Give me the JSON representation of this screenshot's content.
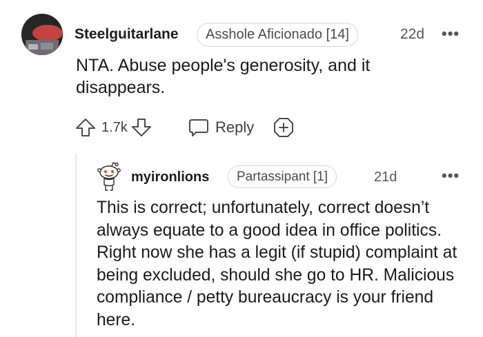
{
  "comment": {
    "username": "Steelguitarlane",
    "flair": "Asshole Aficionado [14]",
    "age": "22d",
    "more": "•••",
    "body": "NTA. Abuse people's generosity, and it disappears.",
    "votes": "1.7k",
    "reply_label": "Reply"
  },
  "reply": {
    "username": "myironlions",
    "flair": "Partassipant [1]",
    "age": "21d",
    "more": "•••",
    "body": "This is correct; unfortunately, correct doesn’t always equate to a good idea in office politics. Right now she has a legit (if stupid) complaint at being excluded, should she go to HR. Malicious compliance / petty bureaucracy is your friend here."
  },
  "icons": {
    "upvote": "upvote-arrow-icon",
    "downvote": "downvote-arrow-icon",
    "reply": "speech-bubble-icon",
    "award": "plus-award-icon",
    "more": "more-options-icon"
  }
}
